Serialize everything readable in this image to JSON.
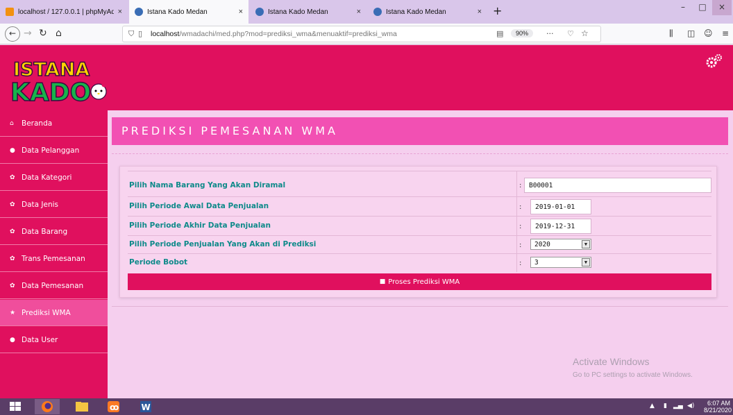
{
  "browser": {
    "tabs": [
      {
        "title": "localhost / 127.0.0.1 | phpMyAd",
        "favicon_color": "#f29111"
      },
      {
        "title": "Istana Kado Medan",
        "favicon_color": "#3a6db5"
      },
      {
        "title": "Istana Kado Medan",
        "favicon_color": "#3a6db5"
      },
      {
        "title": "Istana Kado Medan",
        "favicon_color": "#3a6db5"
      }
    ],
    "new_tab": "+",
    "close": "×",
    "minimize": "–",
    "maximize": "□",
    "url_host": "localhost",
    "url_path": "/wmadachi/med.php?mod=prediksi_wma&menuaktif=prediksi_wma",
    "zoom": "90%",
    "more": "···"
  },
  "header": {
    "logo_line1": "ISTANA",
    "logo_line2": "KADO",
    "colors": {
      "primary": "#e0105e",
      "title_bar": "#f250b3",
      "label": "#0f8a8a"
    }
  },
  "sidebar": {
    "items": [
      {
        "label": "Beranda",
        "icon": "home-icon"
      },
      {
        "label": "Data Pelanggan",
        "icon": "user-icon"
      },
      {
        "label": "Data Kategori",
        "icon": "cogs-icon"
      },
      {
        "label": "Data Jenis",
        "icon": "cogs-icon"
      },
      {
        "label": "Data Barang",
        "icon": "cogs-icon"
      },
      {
        "label": "Trans Pemesanan",
        "icon": "cogs-icon"
      },
      {
        "label": "Data Pemesanan",
        "icon": "cogs-icon"
      },
      {
        "label": "Prediksi WMA",
        "icon": "star-icon"
      },
      {
        "label": "Data User",
        "icon": "user-icon"
      }
    ],
    "active": "Prediksi WMA"
  },
  "main": {
    "title": "PREDIKSI PEMESANAN WMA",
    "form": {
      "barang_label": "Pilih Nama Barang Yang Akan Diramal",
      "barang_value": "B00001",
      "awal_label": "Pilih Periode Awal Data Penjualan",
      "awal_value": "2019-01-01",
      "akhir_label": "Pilih Periode Akhir Data Penjualan",
      "akhir_value": "2019-12-31",
      "prediksi_label": "Pilih Periode Penjualan Yang Akan di Prediksi",
      "prediksi_value": "2020",
      "bobot_label": "Periode Bobot",
      "bobot_value": "3",
      "colon": ":",
      "submit_label": "Proses Prediksi WMA"
    },
    "watermark_title": "Activate Windows",
    "watermark_sub": "Go to PC settings to activate Windows."
  },
  "taskbar": {
    "time": "6:07 AM",
    "date": "8/21/2020"
  }
}
